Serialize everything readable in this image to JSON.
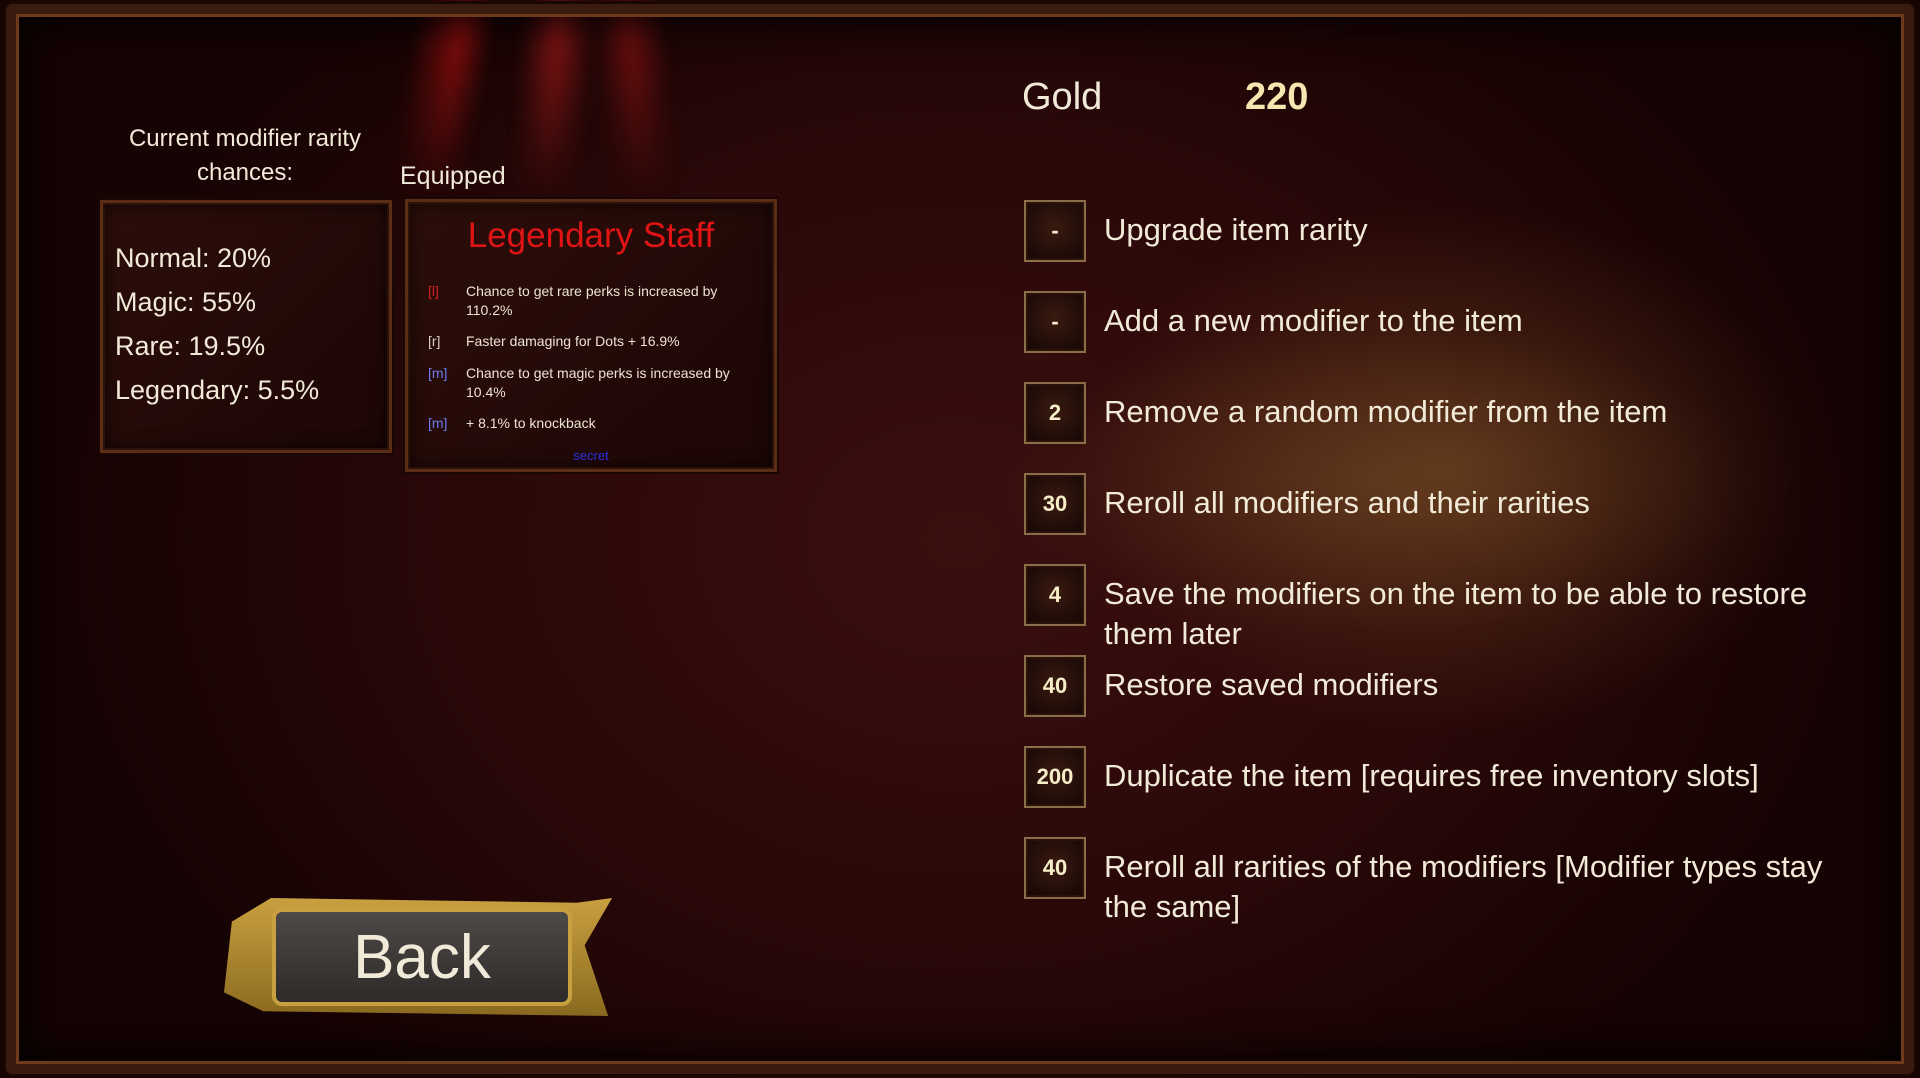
{
  "rarity_panel": {
    "title": "Current modifier rarity chances:",
    "lines": [
      "Normal: 20%",
      "Magic: 55%",
      "Rare: 19.5%",
      "Legendary: 5.5%"
    ]
  },
  "equipped": {
    "label": "Equipped",
    "item_name": "Legendary Staff",
    "mods": [
      {
        "tag": "[l]",
        "text": "Chance to get rare perks is increased by 110.2%"
      },
      {
        "tag": "[r]",
        "text": "Faster damaging for Dots + 16.9%"
      },
      {
        "tag": "[m]",
        "text": "Chance to get magic perks is increased by 10.4%"
      },
      {
        "tag": "[m]",
        "text": "+ 8.1% to knockback"
      }
    ],
    "secret": "secret"
  },
  "gold": {
    "label": "Gold",
    "value": "220"
  },
  "actions": [
    {
      "cost": "-",
      "label": "Upgrade item rarity"
    },
    {
      "cost": "-",
      "label": "Add a new modifier to the item"
    },
    {
      "cost": "2",
      "label": "Remove a random modifier from the item"
    },
    {
      "cost": "30",
      "label": "Reroll all modifiers and their rarities"
    },
    {
      "cost": "4",
      "label": "Save the modifiers on the item to be able to restore them later"
    },
    {
      "cost": "40",
      "label": "Restore saved modifiers"
    },
    {
      "cost": "200",
      "label": "Duplicate the item [requires free inventory slots]"
    },
    {
      "cost": "40",
      "label": "Reroll all rarities of the modifiers [Modifier types stay the same]"
    }
  ],
  "back_label": "Back",
  "colors": {
    "legendary": "#e01414",
    "magic_tag": "#6c7ce8",
    "legendary_tag": "#d42020",
    "gold_value": "#f4e8b0"
  }
}
